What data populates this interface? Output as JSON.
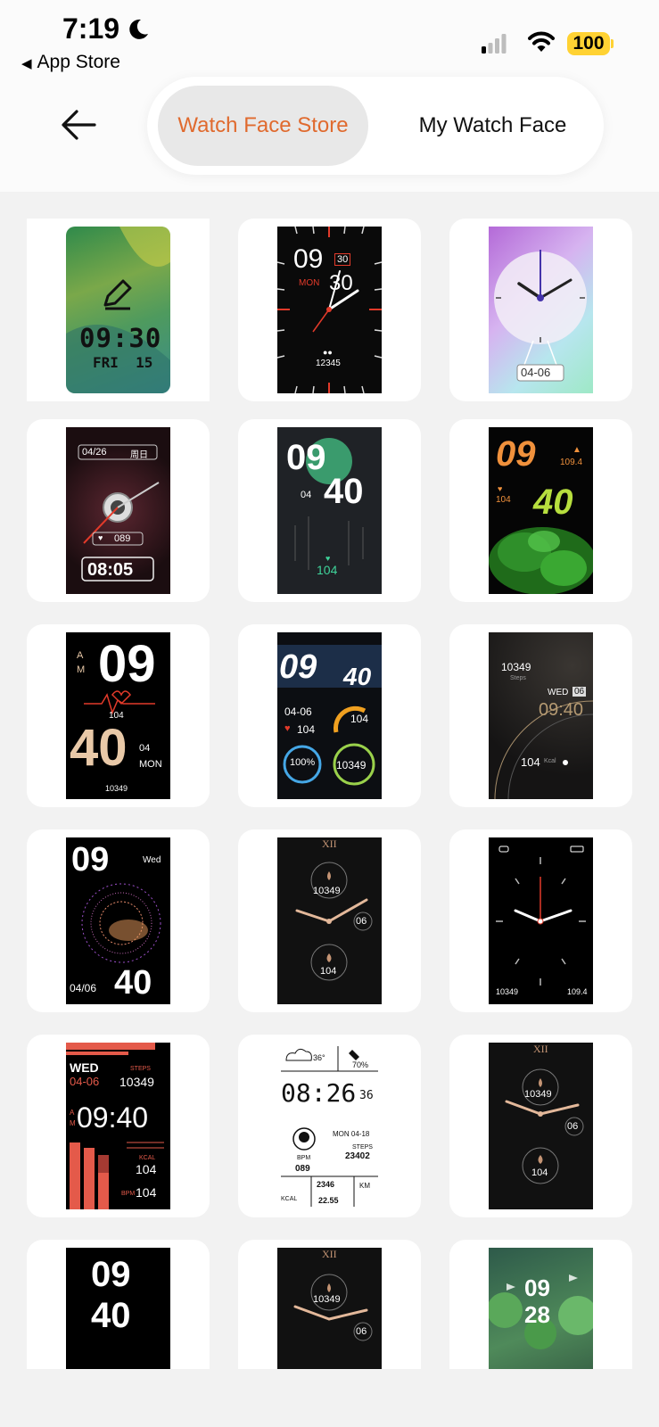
{
  "status_bar": {
    "time": "7:19",
    "back_app": "App Store",
    "battery": "100"
  },
  "header": {
    "tabs": [
      {
        "label": "Watch Face Store",
        "active": true
      },
      {
        "label": "My Watch Face",
        "active": false
      }
    ]
  },
  "colors": {
    "accent": "#e06a2e",
    "battery": "#ffd233",
    "background": "#f2f2f2"
  },
  "faces": [
    {
      "time": "09:30",
      "date": "FRI  15"
    },
    {
      "hour": "09",
      "minute": "30",
      "day_box": "30",
      "weekday": "MON",
      "steps": "12345"
    },
    {
      "date": "04-06"
    },
    {
      "date": "04/26",
      "weekday_cn": "周日",
      "heart": "089",
      "time": "08:05"
    },
    {
      "hour": "09",
      "minute": "40",
      "date": "04",
      "heart": "104"
    },
    {
      "hour": "09",
      "minute": "40",
      "value_top": "109.4",
      "value_left": "104"
    },
    {
      "ampm_a": "A",
      "ampm_m": "M",
      "hour": "09",
      "minute": "40",
      "heart": "104",
      "date": "04",
      "weekday": "MON",
      "steps": "10349"
    },
    {
      "hour": "09",
      "minute": "40",
      "date": "04-06",
      "heart": "104",
      "value_right": "104",
      "battery": "100%",
      "steps": "10349"
    },
    {
      "steps": "10349",
      "steps_label": "Steps",
      "weekday": "WED",
      "day": "06",
      "time": "09:40",
      "kcal": "104",
      "kcal_label": "Kcal"
    },
    {
      "hour": "09",
      "weekday": "Wed",
      "date": "04/06",
      "minute": "40"
    },
    {
      "numeral": "XII",
      "steps": "10349",
      "day": "06",
      "heart": "104"
    },
    {
      "steps": "10349",
      "value_right": "109.4"
    },
    {
      "weekday": "WED",
      "date": "04-06",
      "steps_label": "STEPS",
      "steps": "10349",
      "ampm_a": "A",
      "ampm_m": "M",
      "time": "09:40",
      "kcal_label": "KCAL",
      "kcal": "104",
      "bpm_label": "BPM",
      "bpm": "104"
    },
    {
      "temp": "36°",
      "battery": "70%",
      "time": "08:26",
      "seconds": "36",
      "date": "MON 04-18",
      "steps_label": "STEPS",
      "steps": "23402",
      "bpm_label": "BPM",
      "bpm": "089",
      "kcal_label": "KCAL",
      "kcal": "2346",
      "km_label": "KM",
      "km": "22.55"
    },
    {
      "numeral": "XII",
      "steps": "10349",
      "day": "06",
      "heart": "104"
    },
    {
      "hour": "09",
      "minute": "40"
    },
    {
      "numeral": "XII",
      "steps": "10349",
      "day": "06"
    },
    {
      "hour": "09",
      "minute": "28"
    }
  ]
}
